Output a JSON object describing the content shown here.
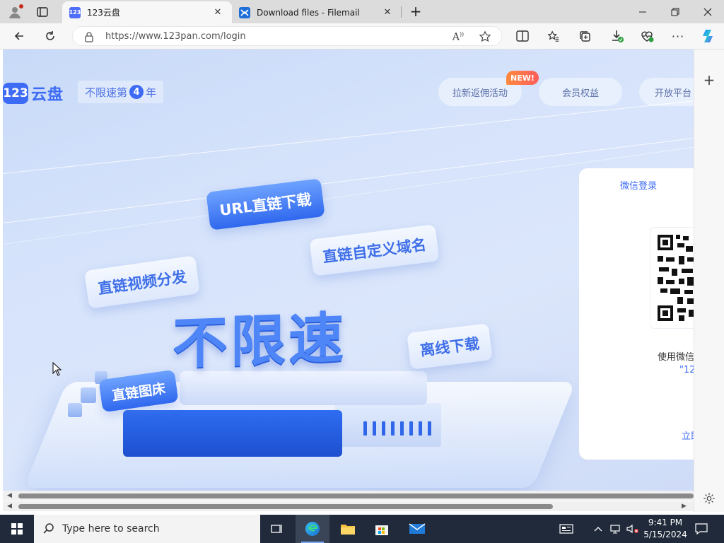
{
  "browser": {
    "tabs": [
      {
        "title": "123云盘",
        "favicon_text": "123",
        "favicon_color": "#4f6ef7"
      },
      {
        "title": "Download files - Filemail",
        "favicon_color": "#1d6fd8"
      }
    ],
    "url": "https://www.123pan.com/login"
  },
  "site": {
    "logo_mark": "123",
    "logo_name": "云盘",
    "slogan_pre": "不限速第",
    "slogan_num": "4",
    "slogan_post": "年",
    "nav": [
      {
        "label": "拉新返佣活动"
      },
      {
        "label": "会员权益"
      },
      {
        "label": "开放平台"
      }
    ],
    "new_badge": "NEW!",
    "hero": {
      "big_word": "不限速",
      "tags": {
        "url_direct": "URL直链下载",
        "custom_domain": "直链自定义域名",
        "video": "直链视频分发",
        "offline": "离线下载",
        "image_bed": "直链图床"
      }
    },
    "login": {
      "title": "微信登录",
      "tip1": "使用微信",
      "tip2": "\"12",
      "link": "立即"
    }
  },
  "taskbar": {
    "search_placeholder": "Type here to search",
    "time": "9:41 PM",
    "date": "5/15/2024"
  },
  "colors": {
    "brand": "#3d6bf5",
    "taskbar": "#202a3a"
  }
}
